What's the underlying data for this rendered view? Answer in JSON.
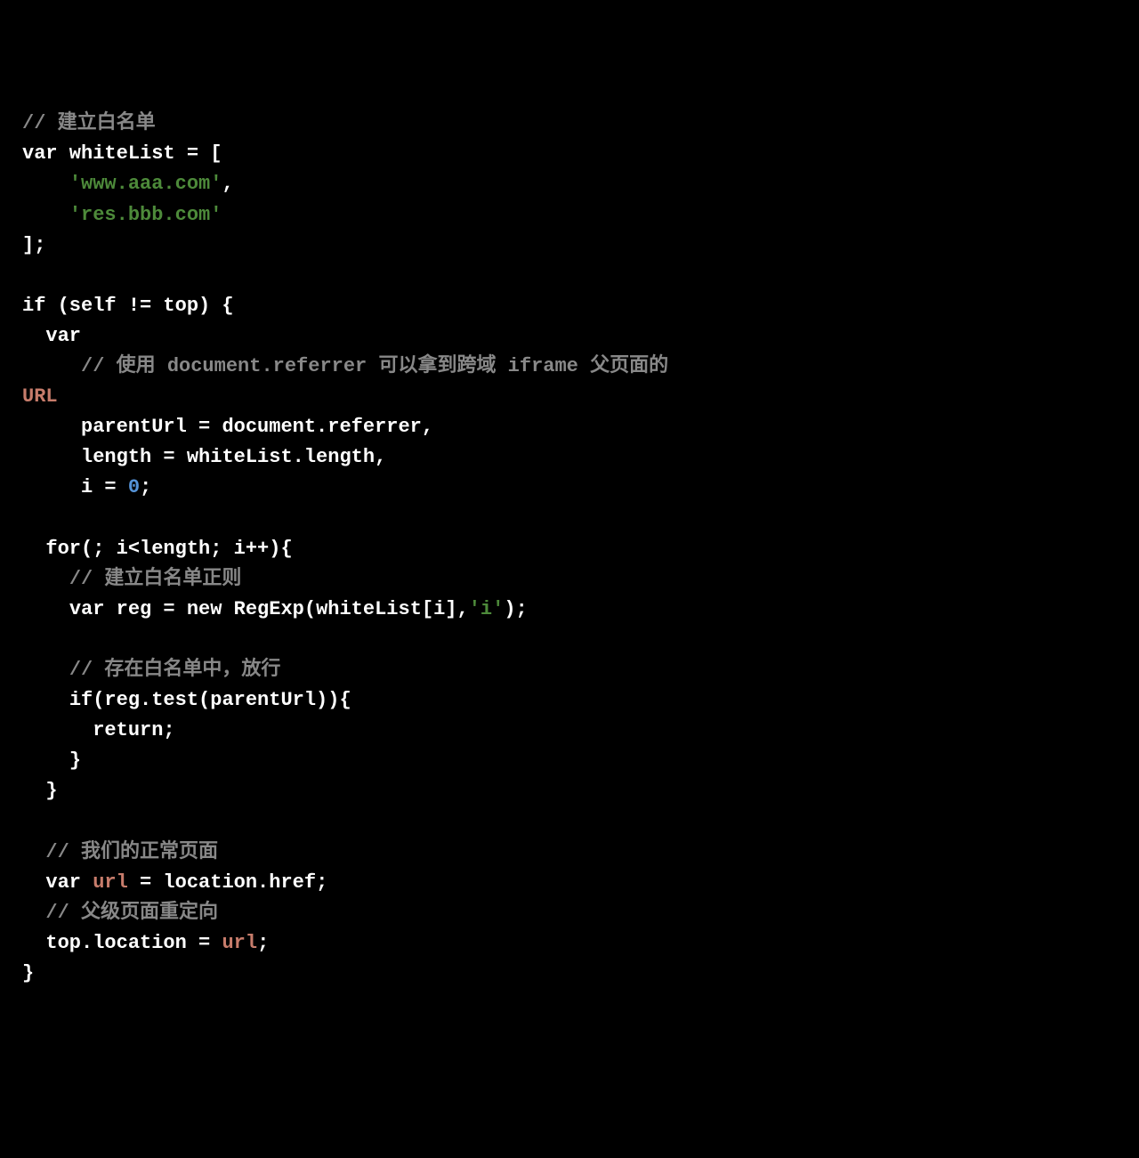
{
  "code": {
    "line1": {
      "comment_marker": "// ",
      "comment_text": "建立白名单"
    },
    "line2": {
      "keyword_var": "var",
      "varname": " whiteList = ["
    },
    "line3": {
      "indent": "    ",
      "string": "'www.aaa.com'",
      "comma": ","
    },
    "line4": {
      "indent": "    ",
      "string": "'res.bbb.com'"
    },
    "line5": {
      "text": "];"
    },
    "line7": {
      "text": "if (self != top) {"
    },
    "line8": {
      "indent": "  ",
      "keyword_var": "var"
    },
    "line9": {
      "indent": "     ",
      "comment_marker": "// ",
      "comment_text": "使用 document.referrer 可以拿到跨域 iframe 父页面的 "
    },
    "line10": {
      "url_label": "URL"
    },
    "line11": {
      "indent": "     ",
      "text": "parentUrl = document.referrer,"
    },
    "line12": {
      "indent": "     ",
      "text": "length = whiteList.length,"
    },
    "line13": {
      "indent": "     ",
      "text_before": "i = ",
      "number": "0",
      "text_after": ";"
    },
    "line15": {
      "indent": "  ",
      "text": "for(; i<length; i++){"
    },
    "line16": {
      "indent": "    ",
      "comment_marker": "// ",
      "comment_text": "建立白名单正则"
    },
    "line17": {
      "indent": "    ",
      "keyword_var": "var",
      "text_before": " reg = ",
      "keyword_new": "new",
      "text_mid": " RegExp(whiteList[i],",
      "string": "'i'",
      "text_after": ");"
    },
    "line19": {
      "indent": "    ",
      "comment_marker": "// ",
      "comment_text": "存在白名单中，放行"
    },
    "line20": {
      "indent": "    ",
      "text": "if(reg.test(parentUrl)){"
    },
    "line21": {
      "indent": "      ",
      "text": "return;"
    },
    "line22": {
      "indent": "    ",
      "text": "}"
    },
    "line23": {
      "indent": "  ",
      "text": "}"
    },
    "line25": {
      "indent": "  ",
      "comment_marker": "// ",
      "comment_text": "我们的正常页面"
    },
    "line26": {
      "indent": "  ",
      "keyword_var": "var",
      "space": " ",
      "identifier": "url",
      "text": " = location.href;"
    },
    "line27": {
      "indent": "  ",
      "comment_marker": "// ",
      "comment_text": "父级页面重定向"
    },
    "line28": {
      "indent": "  ",
      "text_before": "top.location = ",
      "identifier": "url",
      "text_after": ";"
    },
    "line29": {
      "text": "}"
    }
  }
}
